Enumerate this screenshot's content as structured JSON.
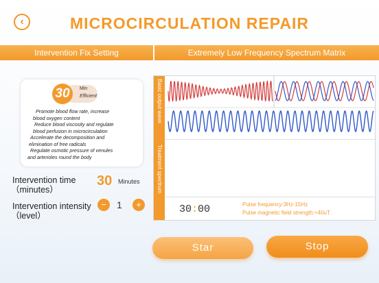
{
  "header": {
    "title": "MICROCIRCULATION REPAIR",
    "back_icon": "chevron-left-icon",
    "left_section": "Intervention Fix Setting",
    "right_section": "Extremely Low Frequency Spectrum Matrix"
  },
  "card": {
    "minutes": "30",
    "unit_line1": "Min",
    "unit_line2": "Efficient",
    "benefits": [
      "Promote blood flow rate, increase",
      "blood oxygen content",
      "Reduce blood viscosity and regulate",
      "blood perfusion in microcirculation",
      "Accelerate the decomposition and",
      "elimination of free radicals",
      "Regulate osmotic pressure of venules",
      "and arterioles round the body"
    ]
  },
  "controls": {
    "time_label_1": "Intervention time",
    "time_label_2": "（minutes）",
    "time_value": "30",
    "time_unit": "Minutes",
    "intensity_label_1": "Intervention intensity",
    "intensity_label_2": "（level）",
    "intensity_value": "1",
    "minus": "−",
    "plus": "+"
  },
  "panel": {
    "side_label_top": "Basic output wave",
    "side_label_bottom": "Treatment spectrum",
    "timer_min": "30",
    "timer_colon": ":",
    "timer_sec": "00",
    "pulse_frequency": "Pulse frequency:3Hz-15Hz",
    "field_strength": "Pulse magnetic field strength:<40uT"
  },
  "buttons": {
    "start": "Star",
    "stop": "Stop"
  },
  "colors": {
    "accent": "#f29a2d",
    "wave_red": "#d23a3a",
    "wave_blue": "#2f58c8"
  }
}
